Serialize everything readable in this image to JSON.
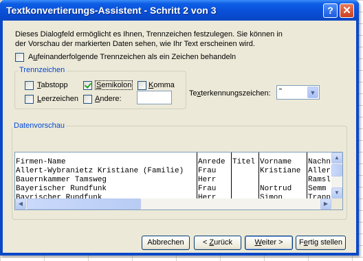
{
  "window": {
    "title": "Textkonvertierungs-Assistent - Schritt 2 von 3",
    "help_label": "?",
    "close_label": "✕"
  },
  "description": {
    "line1": "Dieses Dialogfeld ermöglicht es Ihnen, Trennzeichen festzulegen. Sie können in",
    "line2": "der Vorschau der markierten Daten sehen, wie Ihr Text erscheinen wird."
  },
  "consecutive": {
    "checked": false,
    "label_pre": "A",
    "label_mnemonic": "u",
    "label_post": "feinanderfolgende Trennzeichen als ein Zeichen behandeln"
  },
  "delimiters": {
    "group_title": "Trennzeichen",
    "tab": {
      "label_pre": "",
      "label_mnemonic": "T",
      "label_post": "abstopp",
      "checked": false
    },
    "semicolon": {
      "label_pre": "",
      "label_mnemonic": "S",
      "label_post": "emikolon",
      "checked": true
    },
    "comma": {
      "label_pre": "",
      "label_mnemonic": "K",
      "label_post": "omma",
      "checked": false
    },
    "space": {
      "label_pre": "",
      "label_mnemonic": "L",
      "label_post": "eerzeichen",
      "checked": false
    },
    "other": {
      "label_pre": "",
      "label_mnemonic": "A",
      "label_post": "ndere:",
      "checked": false,
      "value": ""
    }
  },
  "text_qualifier": {
    "label_pre": "Te",
    "label_mnemonic": "x",
    "label_post": "terkennungszeichen:",
    "value": "\""
  },
  "preview": {
    "group_title": "Datenvorschau",
    "columns": [
      "Firmen-Name",
      "Anrede",
      "Titel",
      "Vorname",
      "Nachname"
    ],
    "rows": [
      [
        "Firmen-Name",
        "Anrede",
        "Titel",
        "Vorname",
        "Nachn"
      ],
      [
        "Allert-Wybranietz Kristiane (Familie)",
        "Frau",
        "",
        "Kristiane",
        "Aller"
      ],
      [
        "Bauernkammer Tamsweg",
        "Herr",
        "",
        "",
        "Ramsl"
      ],
      [
        "Bayerischer Rundfunk",
        "Frau",
        "",
        "Nortrud",
        "Semm"
      ],
      [
        "Bayrischer Rundfunk",
        "Herr",
        "",
        "Simon",
        "Trapp"
      ]
    ]
  },
  "buttons": {
    "cancel": "Abbrechen",
    "back_pre": "< ",
    "back_mnemonic": "Z",
    "back_post": "urück",
    "next_pre": "",
    "next_mnemonic": "W",
    "next_post": "eiter >",
    "finish_pre": "F",
    "finish_mnemonic": "e",
    "finish_post": "rtig stellen"
  },
  "scroll_icons": {
    "up": "scroll-up-icon",
    "down": "scroll-down-icon",
    "left": "scroll-left-icon",
    "right": "scroll-right-icon"
  },
  "colors": {
    "title_bar": "#0a4fd8",
    "dialog_face": "#ece9d8",
    "group_title": "#0046d5"
  }
}
